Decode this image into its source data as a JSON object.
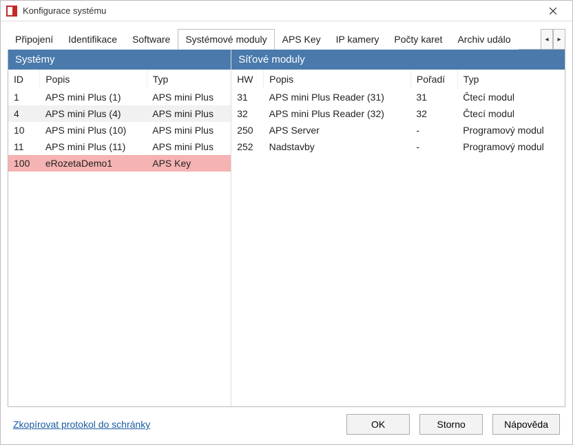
{
  "window": {
    "title": "Konfigurace systému"
  },
  "tabs": [
    {
      "label": "Připojení"
    },
    {
      "label": "Identifikace"
    },
    {
      "label": "Software"
    },
    {
      "label": "Systémové moduly",
      "active": true
    },
    {
      "label": "APS Key"
    },
    {
      "label": "IP kamery"
    },
    {
      "label": "Počty karet"
    },
    {
      "label": "Archiv událo"
    }
  ],
  "systems": {
    "title": "Systémy",
    "columns": {
      "id": "ID",
      "popis": "Popis",
      "typ": "Typ"
    },
    "rows": [
      {
        "id": "1",
        "popis": "APS mini Plus (1)",
        "typ": "APS mini Plus"
      },
      {
        "id": "4",
        "popis": "APS mini Plus (4)",
        "typ": "APS mini Plus",
        "alt": true
      },
      {
        "id": "10",
        "popis": "APS mini Plus (10)",
        "typ": "APS mini Plus"
      },
      {
        "id": "11",
        "popis": "APS mini Plus (11)",
        "typ": "APS mini Plus"
      },
      {
        "id": "100",
        "popis": "eRozetaDemo1",
        "typ": "APS Key",
        "highlight": true
      }
    ]
  },
  "netmodules": {
    "title": "Síťové moduly",
    "columns": {
      "hw": "HW",
      "popis": "Popis",
      "poradi": "Pořadí",
      "typ": "Typ"
    },
    "rows": [
      {
        "hw": "31",
        "popis": "APS mini Plus Reader (31)",
        "poradi": "31",
        "typ": "Čtecí modul"
      },
      {
        "hw": "32",
        "popis": "APS mini Plus Reader (32)",
        "poradi": "32",
        "typ": "Čtecí modul"
      },
      {
        "hw": "250",
        "popis": "APS Server",
        "poradi": "-",
        "typ": "Programový modul"
      },
      {
        "hw": "252",
        "popis": "Nadstavby",
        "poradi": "-",
        "typ": "Programový modul"
      }
    ]
  },
  "footer": {
    "link": "Zkopírovat protokol do schránky",
    "ok": "OK",
    "cancel": "Storno",
    "help": "Nápověda"
  },
  "tabscroll": {
    "left": "◂",
    "right": "▸"
  }
}
